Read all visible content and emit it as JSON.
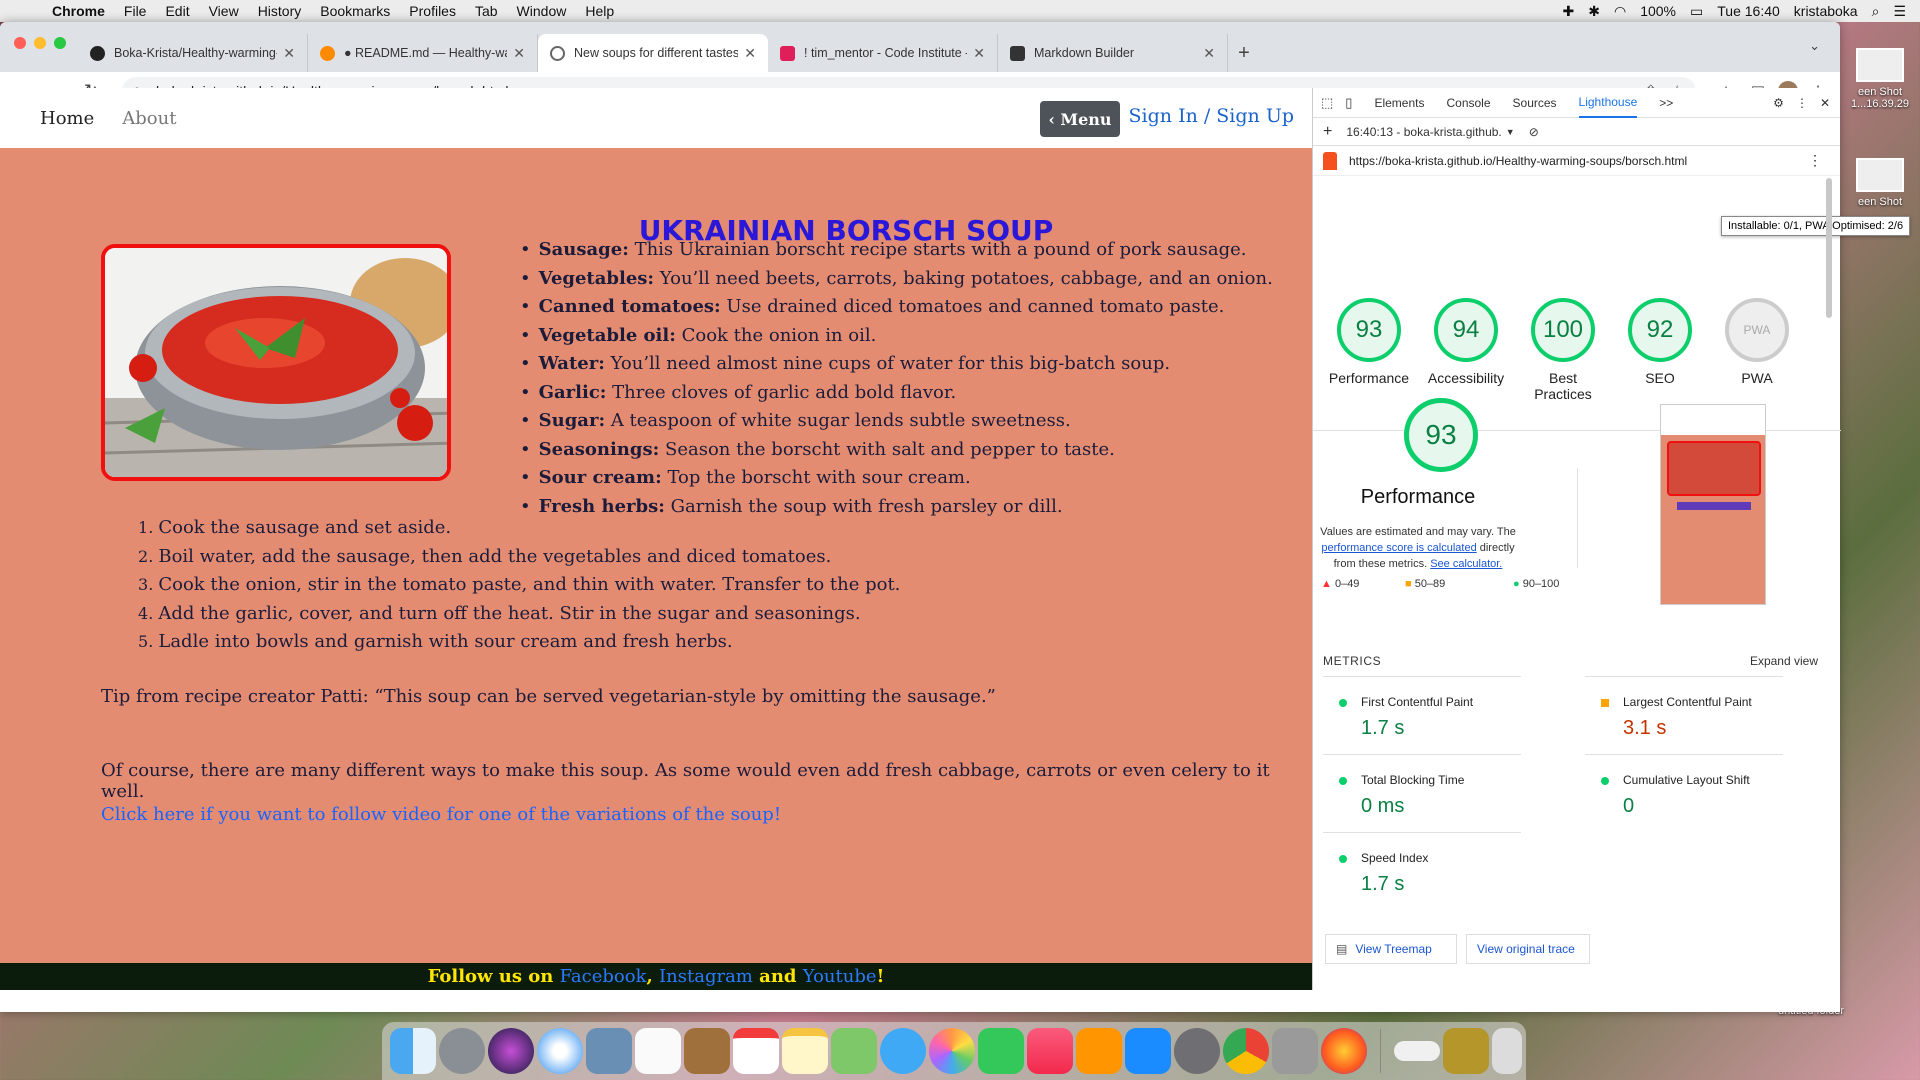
{
  "menubar": {
    "apple_icon": "apple-icon",
    "items": [
      "Chrome",
      "File",
      "Edit",
      "View",
      "History",
      "Bookmarks",
      "Profiles",
      "Tab",
      "Window",
      "Help"
    ],
    "battery": "100%",
    "datetime": "Tue 16:40",
    "user": "kristaboka"
  },
  "tabs": [
    {
      "title": "Boka-Krista/Healthy-warming-",
      "icon": "github-icon",
      "color": "#222"
    },
    {
      "title": "● README.md — Healthy-war",
      "icon": "gitpod-icon",
      "color": "#ff8a00"
    },
    {
      "title": "New soups for different tastes",
      "icon": "globe-icon",
      "color": "#666"
    },
    {
      "title": "! tim_mentor - Code Institute -",
      "icon": "slack-icon",
      "color": "#e01e5a"
    },
    {
      "title": "Markdown Builder",
      "icon": "markdown-icon",
      "color": "#333"
    }
  ],
  "omnibox": {
    "url": "boka-krista.github.io/Healthy-warming-soups/borsch.html"
  },
  "site": {
    "nav": {
      "home": "Home",
      "about": "About",
      "menu": "‹ Menu",
      "signin": "Sign In / Sign Up"
    },
    "heading": "UKRAINIAN BORSCH SOUP",
    "ingredients": [
      {
        "name": "Sausage:",
        "text": " This Ukrainian borscht recipe starts with a pound of pork sausage."
      },
      {
        "name": "Vegetables:",
        "text": " You’ll need beets, carrots, baking potatoes, cabbage, and an onion."
      },
      {
        "name": "Canned tomatoes:",
        "text": " Use drained diced tomatoes and canned tomato paste."
      },
      {
        "name": "Vegetable oil:",
        "text": " Cook the onion in oil."
      },
      {
        "name": "Water:",
        "text": " You’ll need almost nine cups of water for this big-batch soup."
      },
      {
        "name": "Garlic:",
        "text": " Three cloves of garlic add bold flavor."
      },
      {
        "name": "Sugar:",
        "text": " A teaspoon of white sugar lends subtle sweetness."
      },
      {
        "name": "Seasonings:",
        "text": " Season the borscht with salt and pepper to taste."
      },
      {
        "name": "Sour cream:",
        "text": " Top the borscht with sour cream."
      },
      {
        "name": "Fresh herbs:",
        "text": " Garnish the soup with fresh parsley or dill."
      }
    ],
    "steps": [
      "Cook the sausage and set aside.",
      "Boil water, add the sausage, then add the vegetables and diced tomatoes.",
      "Cook the onion, stir in the tomato paste, and thin with water. Transfer to the pot.",
      "Add the garlic, cover, and turn off the heat. Stir in the sugar and seasonings.",
      "Ladle into bowls and garnish with sour cream and fresh herbs."
    ],
    "tip": "Tip from recipe creator Patti: “This soup can be served vegetarian-style by omitting the sausage.”",
    "ofcourse": "Of course, there are many different ways to make this soup. As some would even add fresh cabbage, carrots or even celery to it well.",
    "video_link": "Click here if you want to follow video for one of the variations of the soup!",
    "footer": {
      "pre": "Follow us on ",
      "facebook": "Facebook",
      "comma": ", ",
      "instagram": "Instagram",
      "and": " and ",
      "youtube": "Youtube",
      "bang": "!"
    }
  },
  "devtools": {
    "tabs": [
      "Elements",
      "Console",
      "Sources",
      "Lighthouse"
    ],
    "more": ">>",
    "report_time": "16:40:13 - boka-krista.github.",
    "url": "https://boka-krista.github.io/Healthy-warming-soups/borsch.html",
    "scores": [
      {
        "label": "Performance",
        "score": "93"
      },
      {
        "label": "Accessibility",
        "score": "94"
      },
      {
        "label": "Best Practices",
        "score": "100"
      },
      {
        "label": "SEO",
        "score": "92"
      },
      {
        "label": "PWA",
        "score": "PWA"
      }
    ],
    "tooltip": "Installable: 0/1, PWA Optimised: 2/6",
    "perf_score": "93",
    "perf_title": "Performance",
    "perf_desc_1": "Values are estimated and may vary. The ",
    "perf_desc_link": "performance score is calculated",
    "perf_desc_2": " directly from these metrics. ",
    "perf_desc_calc": "See calculator.",
    "legend": [
      "0–49",
      "50–89",
      "90–100"
    ],
    "metrics_label": "METRICS",
    "expand": "Expand view",
    "metrics": [
      {
        "label": "First Contentful Paint",
        "value": "1.7 s",
        "status": "good"
      },
      {
        "label": "Largest Contentful Paint",
        "value": "3.1 s",
        "status": "average"
      },
      {
        "label": "Total Blocking Time",
        "value": "0 ms",
        "status": "good"
      },
      {
        "label": "Cumulative Layout Shift",
        "value": "0",
        "status": "good"
      },
      {
        "label": "Speed Index",
        "value": "1.7 s",
        "status": "good"
      }
    ],
    "view_treemap": "View Treemap",
    "view_trace": "View original trace"
  },
  "desktop": {
    "icons": [
      {
        "label": "een Shot\n1...16.39.29"
      },
      {
        "label": "een Shot"
      }
    ],
    "folder": "untitled folder"
  },
  "colors": {
    "page_bg": "#e48c72",
    "heading": "#2a17d8",
    "score_green": "#0cce6b",
    "link_blue": "#1a63ff"
  }
}
